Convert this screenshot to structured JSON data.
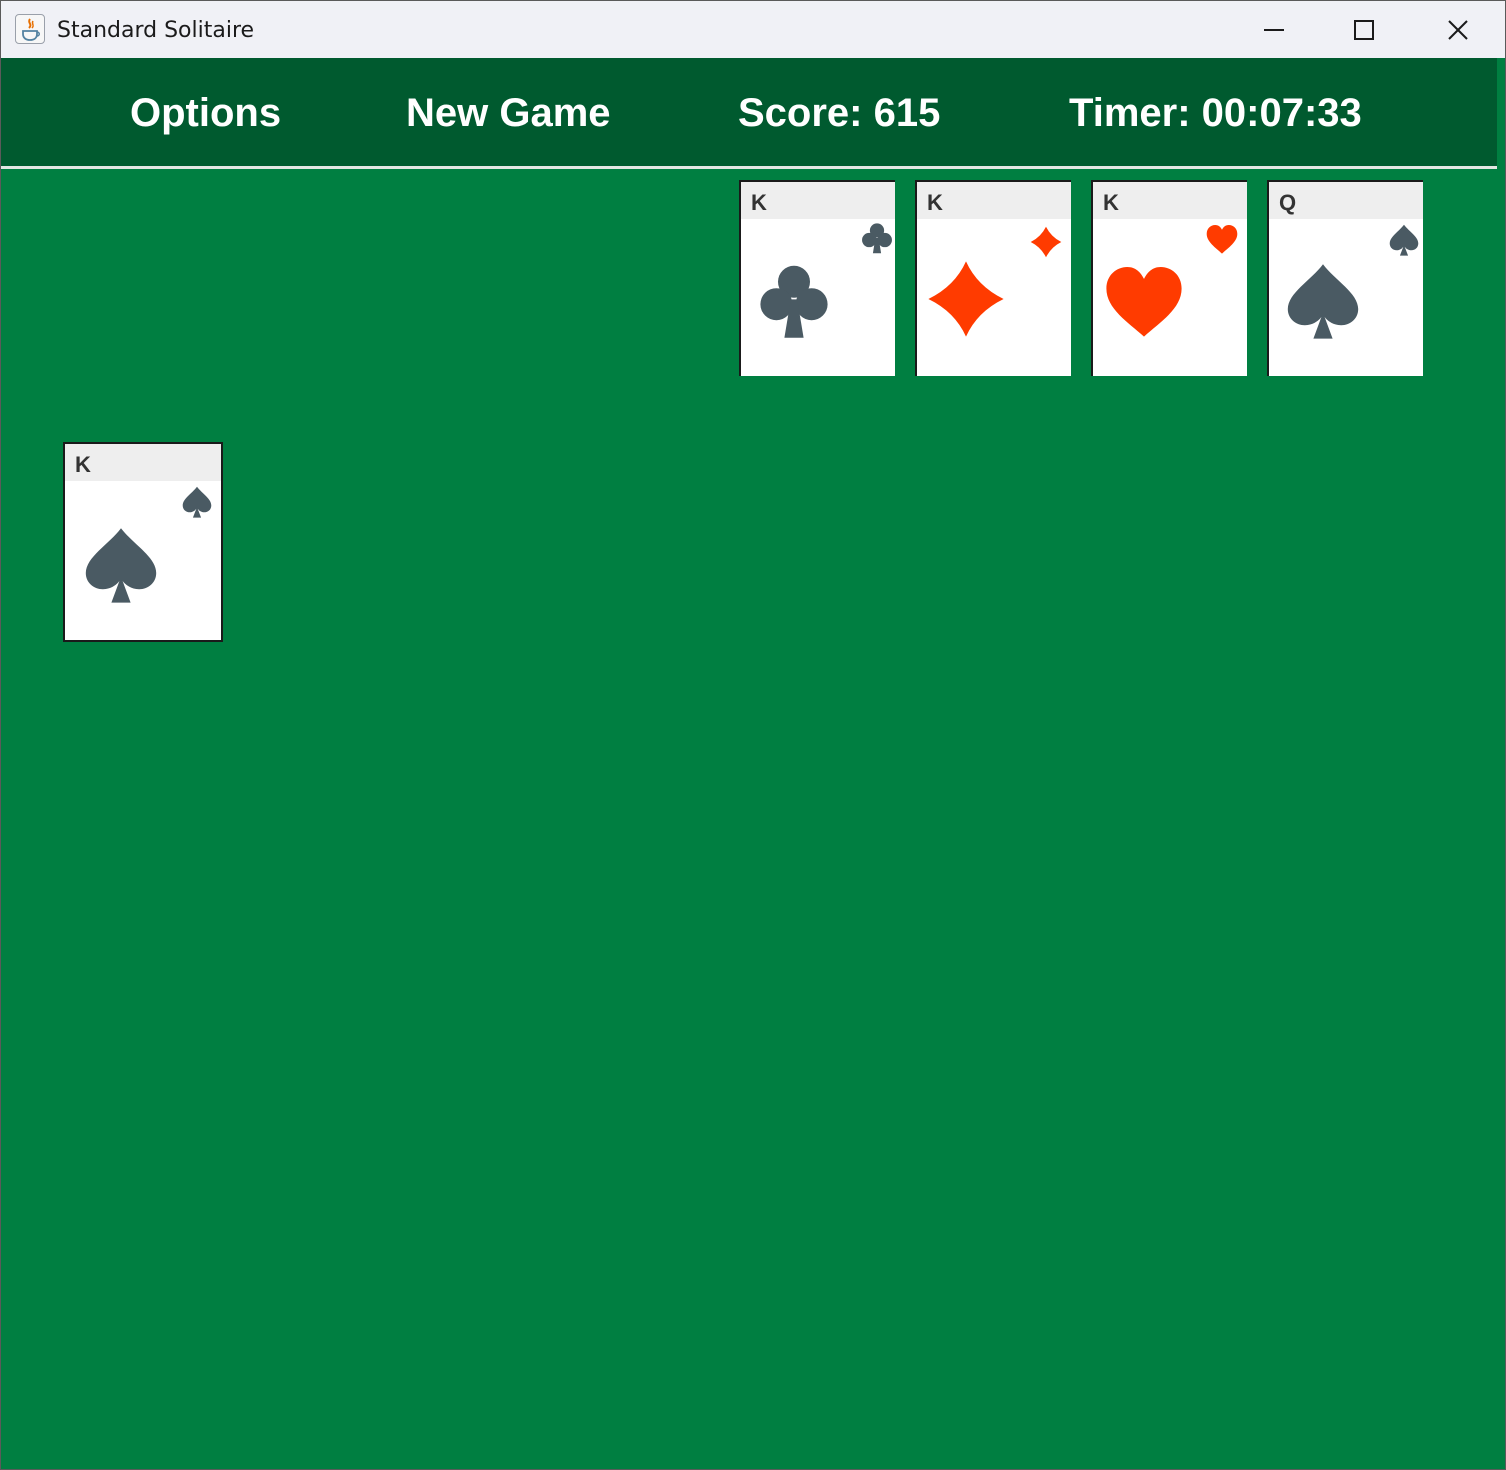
{
  "window": {
    "title": "Standard Solitaire"
  },
  "menu": {
    "options_label": "Options",
    "new_game_label": "New Game",
    "score_text": "Score: 615",
    "timer_text": "Timer: 00:07:33"
  },
  "colors": {
    "felt": "#007f41",
    "menubar": "#005a2f",
    "dark_suit": "#4a5a63",
    "red_suit": "#ff3b00"
  },
  "foundations": [
    {
      "rank": "K",
      "suit": "clubs",
      "color": "dark"
    },
    {
      "rank": "K",
      "suit": "diamonds",
      "color": "red"
    },
    {
      "rank": "K",
      "suit": "hearts",
      "color": "red"
    },
    {
      "rank": "Q",
      "suit": "spades",
      "color": "dark"
    }
  ],
  "tableau": [
    {
      "rank": "K",
      "suit": "spades",
      "color": "dark"
    }
  ]
}
